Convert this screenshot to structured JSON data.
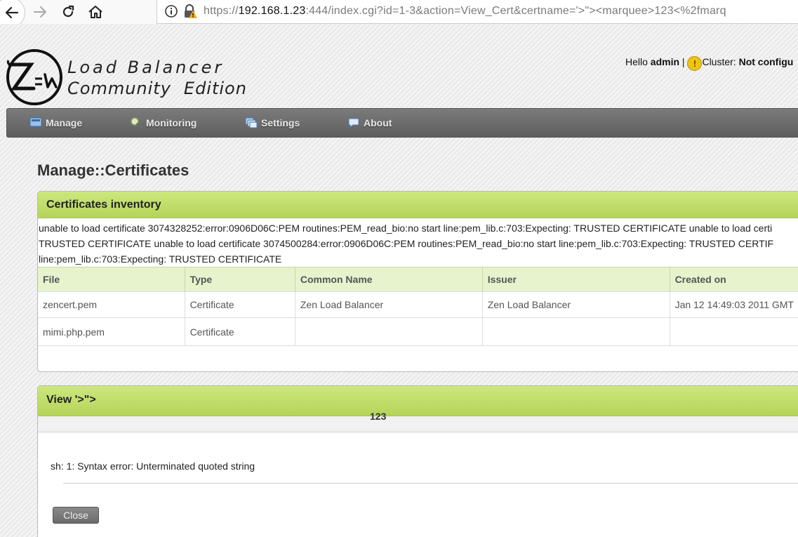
{
  "browser": {
    "url_scheme": "https://",
    "url_host": "192.168.1.23",
    "url_rest": ":444/index.cgi?id=1-3&action=View_Cert&certname='>\"><marquee>123<%2fmarq"
  },
  "logo": {
    "line1": "Load Balancer",
    "line2_a": "Community",
    "line2_b": "Edition"
  },
  "header": {
    "hello": "Hello",
    "user": "admin",
    "separator": "|",
    "warn_glyph": "!",
    "cluster_label": "Cluster:",
    "cluster_value": "Not configu"
  },
  "menu": [
    {
      "label": "Manage",
      "icon": "manage-icon"
    },
    {
      "label": "Monitoring",
      "icon": "monitoring-icon"
    },
    {
      "label": "Settings",
      "icon": "settings-icon"
    },
    {
      "label": "About",
      "icon": "about-icon"
    }
  ],
  "page_title": "Manage::Certificates",
  "inventory": {
    "title": "Certificates inventory",
    "error_lines": [
      "unable to load certificate 3074328252:error:0906D06C:PEM routines:PEM_read_bio:no start line:pem_lib.c:703:Expecting: TRUSTED CERTIFICATE unable to load certi",
      "TRUSTED CERTIFICATE unable to load certificate 3074500284:error:0906D06C:PEM routines:PEM_read_bio:no start line:pem_lib.c:703:Expecting: TRUSTED CERTIF",
      "line:pem_lib.c:703:Expecting: TRUSTED CERTIFICATE"
    ],
    "columns": [
      "File",
      "Type",
      "Common Name",
      "Issuer",
      "Created on"
    ],
    "rows": [
      [
        "zencert.pem",
        "Certificate",
        "Zen Load Balancer",
        "Zen Load Balancer",
        "Jan 12 14:49:03 2011 GMT"
      ],
      [
        "mimi.php.pem",
        "Certificate",
        "",
        "",
        ""
      ]
    ]
  },
  "view": {
    "title": "View '>\">",
    "marquee": "123",
    "error": "sh: 1: Syntax error: Unterminated quoted string",
    "close_label": "Close"
  },
  "colors": {
    "panel_header": "#c4df6e",
    "table_header": "#e6f3cd",
    "menu_bar": "#6a6a6a",
    "warning": "#f1c40f"
  }
}
